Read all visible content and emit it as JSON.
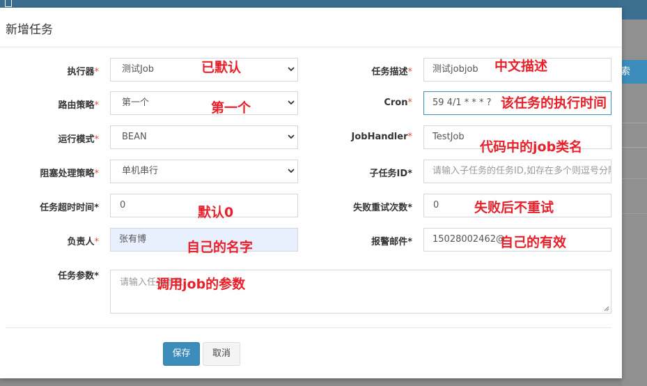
{
  "modal": {
    "title": "新增任务"
  },
  "background": {
    "button_label": "索"
  },
  "form": {
    "executor": {
      "label": "执行器",
      "value": "测试Job",
      "annotation": "已默认"
    },
    "route_strategy": {
      "label": "路由策略",
      "value": "第一个",
      "annotation": "第一个"
    },
    "run_mode": {
      "label": "运行模式",
      "value": "BEAN"
    },
    "block_strategy": {
      "label": "阻塞处理策略",
      "value": "单机串行"
    },
    "timeout": {
      "label": "任务超时时间",
      "value": "0",
      "annotation": "默认0"
    },
    "owner": {
      "label": "负责人",
      "value": "张有博",
      "annotation": "自己的名字"
    },
    "params": {
      "label": "任务参数",
      "placeholder": "请输入任务参数",
      "annotation": "调用job的参数"
    },
    "description": {
      "label": "任务描述",
      "value": "测试jobjob",
      "annotation": "中文描述"
    },
    "cron": {
      "label": "Cron",
      "value": "59 4/1 * * * ?",
      "annotation": "该任务的执行时间"
    },
    "job_handler": {
      "label": "JobHandler",
      "value": "TestJob",
      "annotation": "代码中的job类名"
    },
    "child_job": {
      "label": "子任务ID",
      "placeholder": "请输入子任务的任务ID,如存在多个则逗号分隔"
    },
    "retry": {
      "label": "失败重试次数",
      "value": "0",
      "annotation": "失败后不重试"
    },
    "alarm_email": {
      "label": "报警邮件",
      "value": "15028002462@",
      "annotation": "自己的有效"
    },
    "required_mark": "*"
  },
  "buttons": {
    "save": "保存",
    "cancel": "取消"
  },
  "colors": {
    "primary": "#3c8dbc",
    "required": "#dd4b39",
    "annotation": "#e8202a"
  }
}
